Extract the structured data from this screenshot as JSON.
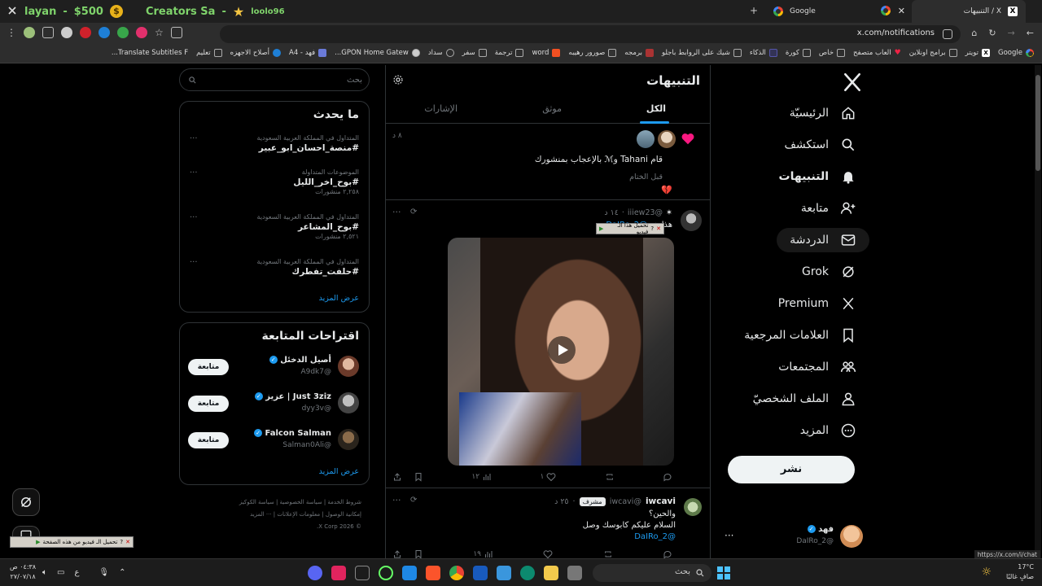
{
  "browser": {
    "stream_overlay": {
      "name": "layan",
      "amount": "$500",
      "tag": "Creators Sa",
      "user": "loolo96"
    },
    "tabs": [
      {
        "label": "Google"
      },
      {
        "label": "التنبيهات / X"
      }
    ],
    "url": "x.com/notifications",
    "bookmarks": [
      "Google",
      "تويتر",
      "برامج اونلاين",
      "العاب متصفح",
      "خاص",
      "كورة",
      "الذكاء",
      "شيك على الروابط باجلو",
      "برمجه",
      "صورور رهيبه",
      "word",
      "ترجمة",
      "سفر",
      "سداد",
      "GPON Home Gatew...",
      "فهد - A4",
      "أصلاح الاجهزه",
      "تعليم",
      "Translate Subtitles F..."
    ]
  },
  "nav": {
    "items": [
      {
        "label": "الرئيسيّة",
        "icon": "home-icon"
      },
      {
        "label": "استكشف",
        "icon": "search-icon"
      },
      {
        "label": "التنبيهات",
        "icon": "bell-icon"
      },
      {
        "label": "متابعة",
        "icon": "add-user-icon"
      },
      {
        "label": "الدردشة",
        "icon": "mail-icon"
      },
      {
        "label": "Grok",
        "icon": "grok-icon"
      },
      {
        "label": "Premium",
        "icon": "x-icon"
      },
      {
        "label": "العلامات المرجعية",
        "icon": "bookmark-icon"
      },
      {
        "label": "المجتمعات",
        "icon": "communities-icon"
      },
      {
        "label": "الملف الشخصيّ",
        "icon": "profile-icon"
      },
      {
        "label": "المزيد",
        "icon": "more-icon"
      }
    ],
    "post_label": "نشر",
    "account": {
      "name": "فهد",
      "handle": "@DaIRo_2"
    }
  },
  "main": {
    "title": "التنبيهات",
    "tabs": [
      "الكل",
      "موثق",
      "الإشارات"
    ],
    "like_notif": {
      "text": "قام Tahani وℳ بالإعجاب بمنشورك",
      "time": "٨ د",
      "quote": "قبل الختام",
      "emoji": "💔"
    },
    "tweet1": {
      "handle": "@iiiew23",
      "time": "١٤ د",
      "text": "هذا هو",
      "mention": "@DaIRo_2",
      "stats": {
        "replies": "",
        "reposts": "",
        "likes": "١",
        "views": "١٢"
      }
    },
    "tweet2": {
      "name": "iwcavi",
      "handle": "@iwcavi",
      "badge": "مشرف",
      "time": "٢٥ د",
      "line1": "والحين؟",
      "line2": "السلام عليكم كابوسك وصل",
      "mention": "@DaIRo_2",
      "stats": {
        "views": "١٩"
      }
    }
  },
  "side": {
    "search_placeholder": "بحث",
    "trending_title": "ما يحدث",
    "trends": [
      {
        "meta": "المتداول في المملكة العربية السعودية",
        "tag": "#منصة_احسان_ابو_عبير",
        "count": ""
      },
      {
        "meta": "الموضوعات المتداولة",
        "tag": "#بوح_اخر_الليل",
        "count": "٢,٢٥٨ منشورات"
      },
      {
        "meta": "المتداول في المملكة العربية السعودية",
        "tag": "#بوح_المشاعر",
        "count": "٢,٥٢١ منشورات"
      },
      {
        "meta": "المتداول في المملكة العربية السعودية",
        "tag": "#حلفت_تفطرك",
        "count": ""
      }
    ],
    "show_more": "عرض المزيد",
    "follow_title": "اقتراحات المتابعة",
    "follow": [
      {
        "name": "أصيل الدخئل",
        "handle": "@A9dk7"
      },
      {
        "name": "Just 3ziz | عزيز",
        "handle": "@dyy3v"
      },
      {
        "name": "Falcon Salman",
        "handle": "@Salman0Ali"
      }
    ],
    "follow_label": "متابعة",
    "footer": [
      "شروط الخدمة",
      "سياسة الخصوصية",
      "سياسة الكوكيز",
      "إمكانية الوصول",
      "معلومات الإعلانات",
      "··· المزيد",
      "© 2026 X Corp."
    ]
  },
  "overlays": {
    "video_download": "تحميل هذا الـ فيديو",
    "video_download_page": "تحميل الـ فيديو من هذه الصفحة",
    "status_url": "https://x.com/i/chat"
  },
  "taskbar": {
    "time": "٠٤:٣٨ ص",
    "date": "٢٧/٠٧/١٨",
    "lang": "ع",
    "search": "بحث",
    "weather_temp": "17°C",
    "weather_text": "صافٍ غالبًا"
  },
  "colors": {
    "accent": "#1d9bf0",
    "like": "#f91880",
    "background": "#000000"
  }
}
